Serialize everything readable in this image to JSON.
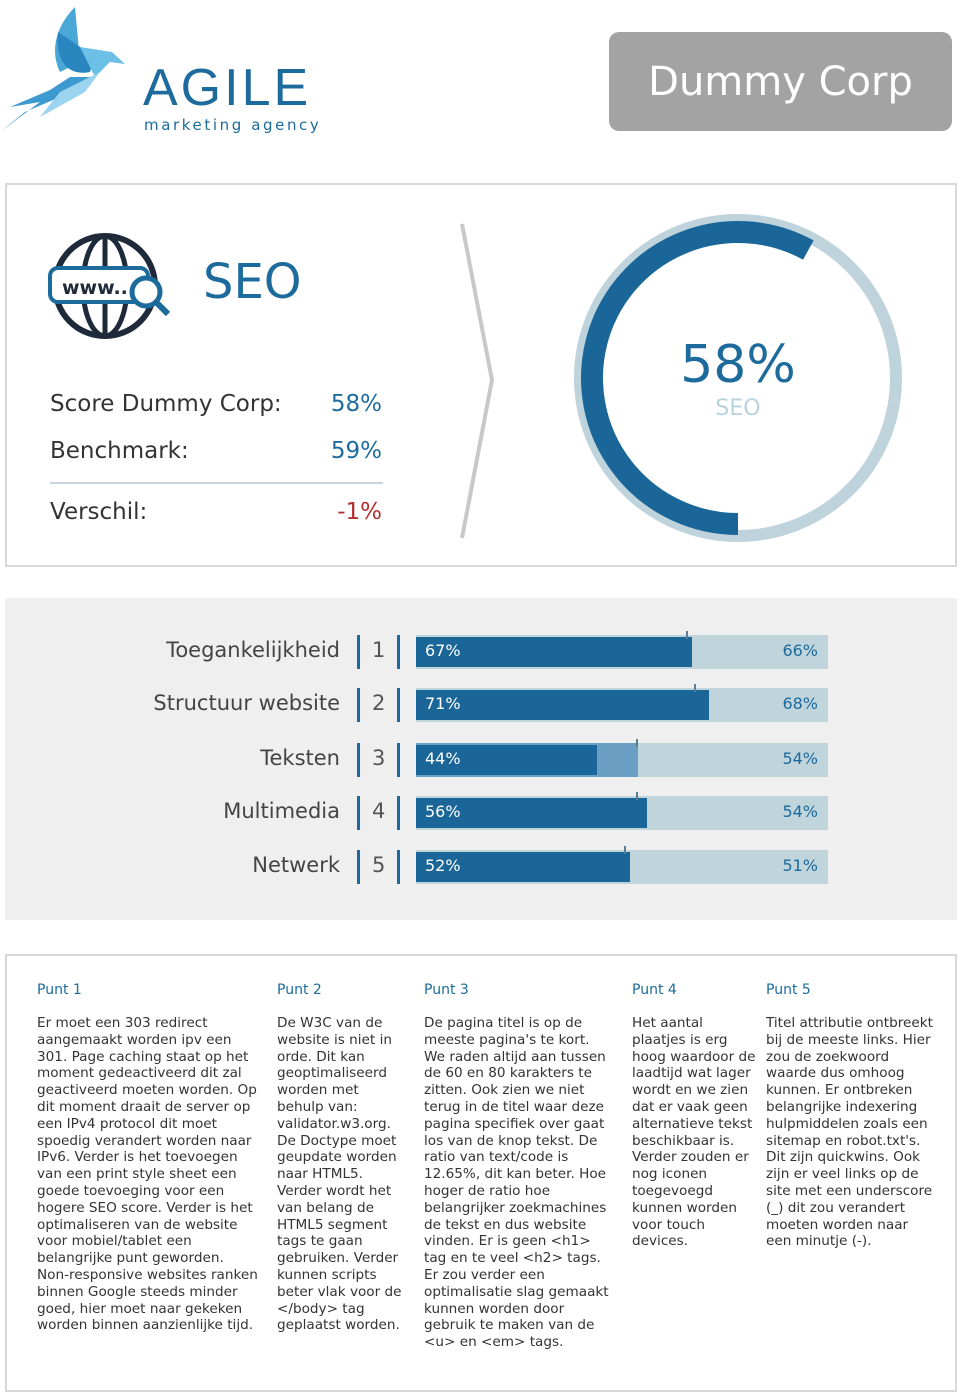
{
  "header": {
    "logo_title": "AGILE",
    "logo_subtitle": "marketing agency",
    "client": "Dummy Corp"
  },
  "seo": {
    "title": "SEO",
    "icon": "www-globe-search-icon",
    "score_label": "Score Dummy Corp:",
    "score_value": "58%",
    "benchmark_label": "Benchmark:",
    "benchmark_value": "59%",
    "diff_label": "Verschil:",
    "diff_value": "-1%",
    "donut_value": "58%",
    "donut_label": "SEO",
    "donut_fraction": 0.58,
    "colors": {
      "primary": "#1a6699",
      "light": "#bfd3dc",
      "negative": "#b03030"
    }
  },
  "categories": [
    {
      "name": "Toegankelijkheid",
      "index": "1",
      "score": 67,
      "score_label": "67%",
      "benchmark": 66,
      "benchmark_label": "66%"
    },
    {
      "name": "Structuur website",
      "index": "2",
      "score": 71,
      "score_label": "71%",
      "benchmark": 68,
      "benchmark_label": "68%"
    },
    {
      "name": "Teksten",
      "index": "3",
      "score": 44,
      "score_label": "44%",
      "benchmark": 54,
      "benchmark_label": "54%"
    },
    {
      "name": "Multimedia",
      "index": "4",
      "score": 56,
      "score_label": "56%",
      "benchmark": 54,
      "benchmark_label": "54%"
    },
    {
      "name": "Netwerk",
      "index": "5",
      "score": 52,
      "score_label": "52%",
      "benchmark": 51,
      "benchmark_label": "51%"
    }
  ],
  "points": [
    {
      "title": "Punt 1",
      "text": "Er moet een 303 redirect aangemaakt worden ipv een 301. Page caching staat op het moment gedeactiveerd dit zal geactiveerd moeten worden. Op dit moment draait de server op een IPv4 protocol dit moet spoedig verandert worden naar IPv6. Verder is het toevoegen van een print style sheet een goede toevoeging voor een hogere SEO score. Verder is het optimaliseren van de website voor mobiel/tablet een belangrijke punt geworden. Non-responsive websites ranken binnen Google steeds minder goed, hier moet naar gekeken worden binnen aanzienlijke tijd."
    },
    {
      "title": "Punt 2",
      "text": "De W3C van de website is niet in orde. Dit kan geoptimaliseerd worden met behulp van: validator.w3.org. De Doctype moet geupdate worden naar HTML5. Verder wordt het van belang de HTML5 segment tags te gaan gebruiken. Verder kunnen scripts beter vlak voor de </body> tag geplaatst worden."
    },
    {
      "title": "Punt 3",
      "text": "De pagina titel is op de meeste pagina's te kort. We raden altijd aan tussen de 60 en 80 karakters te zitten. Ook zien we niet terug in de titel waar deze pagina specifiek over gaat los van de knop tekst. De ratio van text/code is 12.65%, dit kan beter. Hoe hoger de ratio hoe belangrijker zoekmachines de tekst en dus website vinden. Er is geen <h1> tag en te veel <h2> tags. Er zou verder een optimalisatie slag gemaakt kunnen worden door gebruik te maken van de <u> en <em> tags."
    },
    {
      "title": "Punt 4",
      "text": "Het aantal plaatjes is erg hoog waardoor de laadtijd wat lager wordt en we zien dat er vaak geen alternatieve tekst beschikbaar is. Verder zouden er nog iconen toegevoegd kunnen worden voor touch devices."
    },
    {
      "title": "Punt 5",
      "text": "Titel attributie ontbreekt bij de meeste links. Hier zou de zoekwoord waarde dus omhoog kunnen. Er ontbreken belangrijke indexering hulpmiddelen zoals een sitemap en robot.txt's. Dit zijn quickwins. Ook zijn er veel links op de site met een underscore (_) dit zou verandert moeten worden naar een minutje (-)."
    }
  ]
}
